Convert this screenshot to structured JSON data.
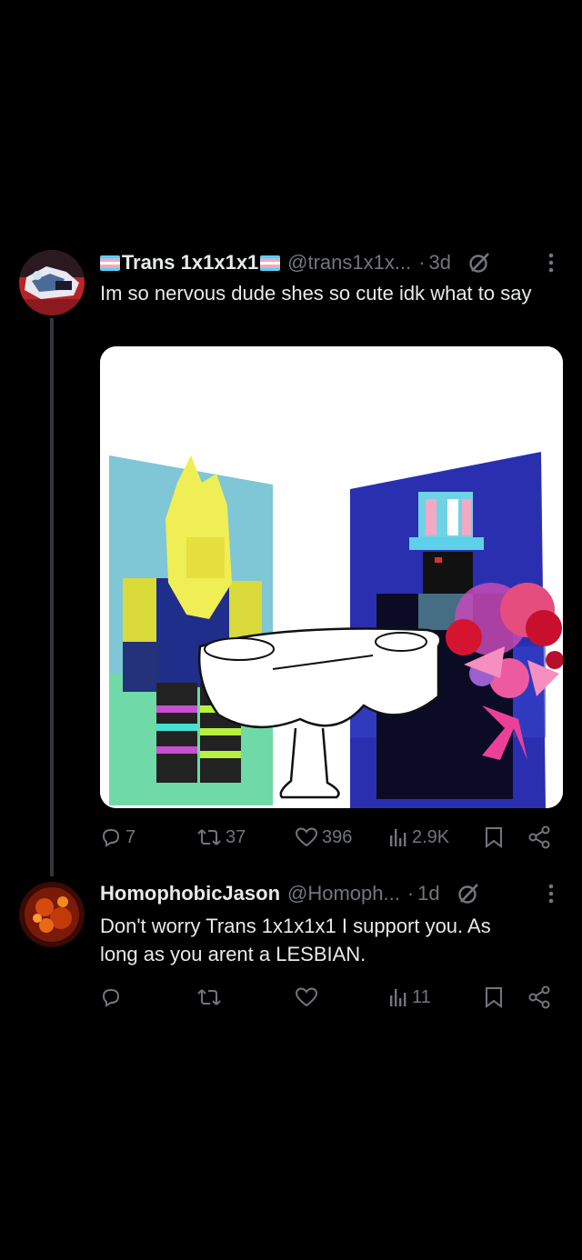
{
  "tweets": [
    {
      "display_name": "Trans 1x1x1x1",
      "handle": "@trans1x1x...",
      "separator": "·",
      "time": "3d",
      "text": "Im so nervous dude shes so cute idk what to say",
      "stats": {
        "replies": "7",
        "reposts": "37",
        "likes": "396",
        "views": "2.9K"
      }
    },
    {
      "display_name": "HomophobicJason",
      "handle": "@Homoph...",
      "separator": "·",
      "time": "1d",
      "text": "Don't worry Trans 1x1x1x1 I support you. As long as you arent a LESBIAN.",
      "stats": {
        "views": "11"
      }
    }
  ],
  "colors": {
    "background": "#000000",
    "text": "#e7e9ea",
    "muted": "#71767b",
    "thread_line": "#333639"
  },
  "icons": [
    "trans-flag-icon",
    "grok-icon",
    "more-icon",
    "reply-icon",
    "repost-icon",
    "like-icon",
    "views-icon",
    "bookmark-icon",
    "share-icon"
  ]
}
